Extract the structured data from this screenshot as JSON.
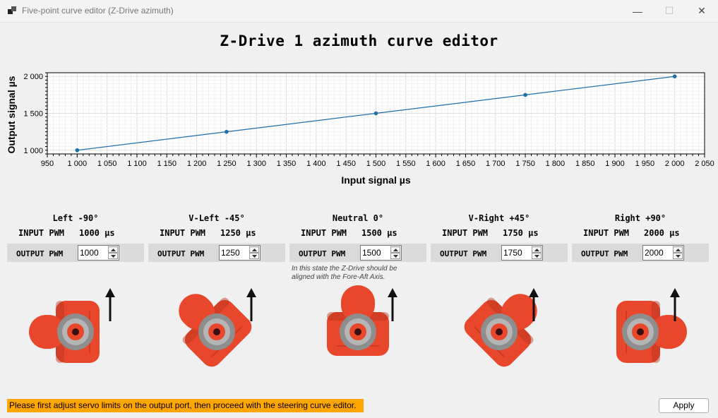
{
  "window": {
    "title": "Five-point curve editor (Z-Drive azimuth)",
    "minimize_glyph": "—",
    "maximize_glyph": "☐",
    "close_glyph": "✕"
  },
  "editor_title": "Z-Drive 1 azimuth curve editor",
  "chart_data": {
    "type": "line",
    "xlabel": "Input signal µs",
    "ylabel": "Output signal µs",
    "xlim": [
      950,
      2050
    ],
    "ylim": [
      950,
      2050
    ],
    "x_ticks": [
      "950",
      "1 000",
      "1 050",
      "1 100",
      "1 150",
      "1 200",
      "1 250",
      "1 300",
      "1 350",
      "1 400",
      "1 450",
      "1 500",
      "1 550",
      "1 600",
      "1 650",
      "1 700",
      "1 750",
      "1 800",
      "1 850",
      "1 900",
      "1 950",
      "2 000",
      "2 050"
    ],
    "y_ticks": [
      "1 000",
      "1 500",
      "2 000"
    ],
    "grid": true,
    "line_color": "#1f6fa8",
    "series": [
      {
        "x": [
          1000,
          1250,
          1500,
          1750,
          2000
        ],
        "y": [
          1000,
          1250,
          1500,
          1750,
          2000
        ]
      }
    ]
  },
  "positions": [
    {
      "name": "Left -90°",
      "input_label": "INPUT PWM",
      "input_value": "1000 µs",
      "output_label": "OUTPUT PWM",
      "output_value": "1000",
      "angle": -90
    },
    {
      "name": "V-Left -45°",
      "input_label": "INPUT PWM",
      "input_value": "1250 µs",
      "output_label": "OUTPUT PWM",
      "output_value": "1250",
      "angle": -45
    },
    {
      "name": "Neutral 0°",
      "input_label": "INPUT PWM",
      "input_value": "1500 µs",
      "output_label": "OUTPUT PWM",
      "output_value": "1500",
      "angle": 0,
      "note": "In this state the Z-Drive should be aligned with the Fore-Aft Axis."
    },
    {
      "name": "V-Right +45°",
      "input_label": "INPUT PWM",
      "input_value": "1750 µs",
      "output_label": "OUTPUT PWM",
      "output_value": "1750",
      "angle": 45
    },
    {
      "name": "Right +90°",
      "input_label": "INPUT PWM",
      "input_value": "2000 µs",
      "output_label": "OUTPUT PWM",
      "output_value": "2000",
      "angle": 90
    }
  ],
  "colors": {
    "thruster": "#e8472c",
    "thruster_dark": "#b8331d",
    "hub": "#8e8e8e",
    "warning": "#ffa500"
  },
  "warning_text": "Please first adjust servo limits on the output port, then proceed with the steering curve editor.",
  "apply_label": "Apply"
}
